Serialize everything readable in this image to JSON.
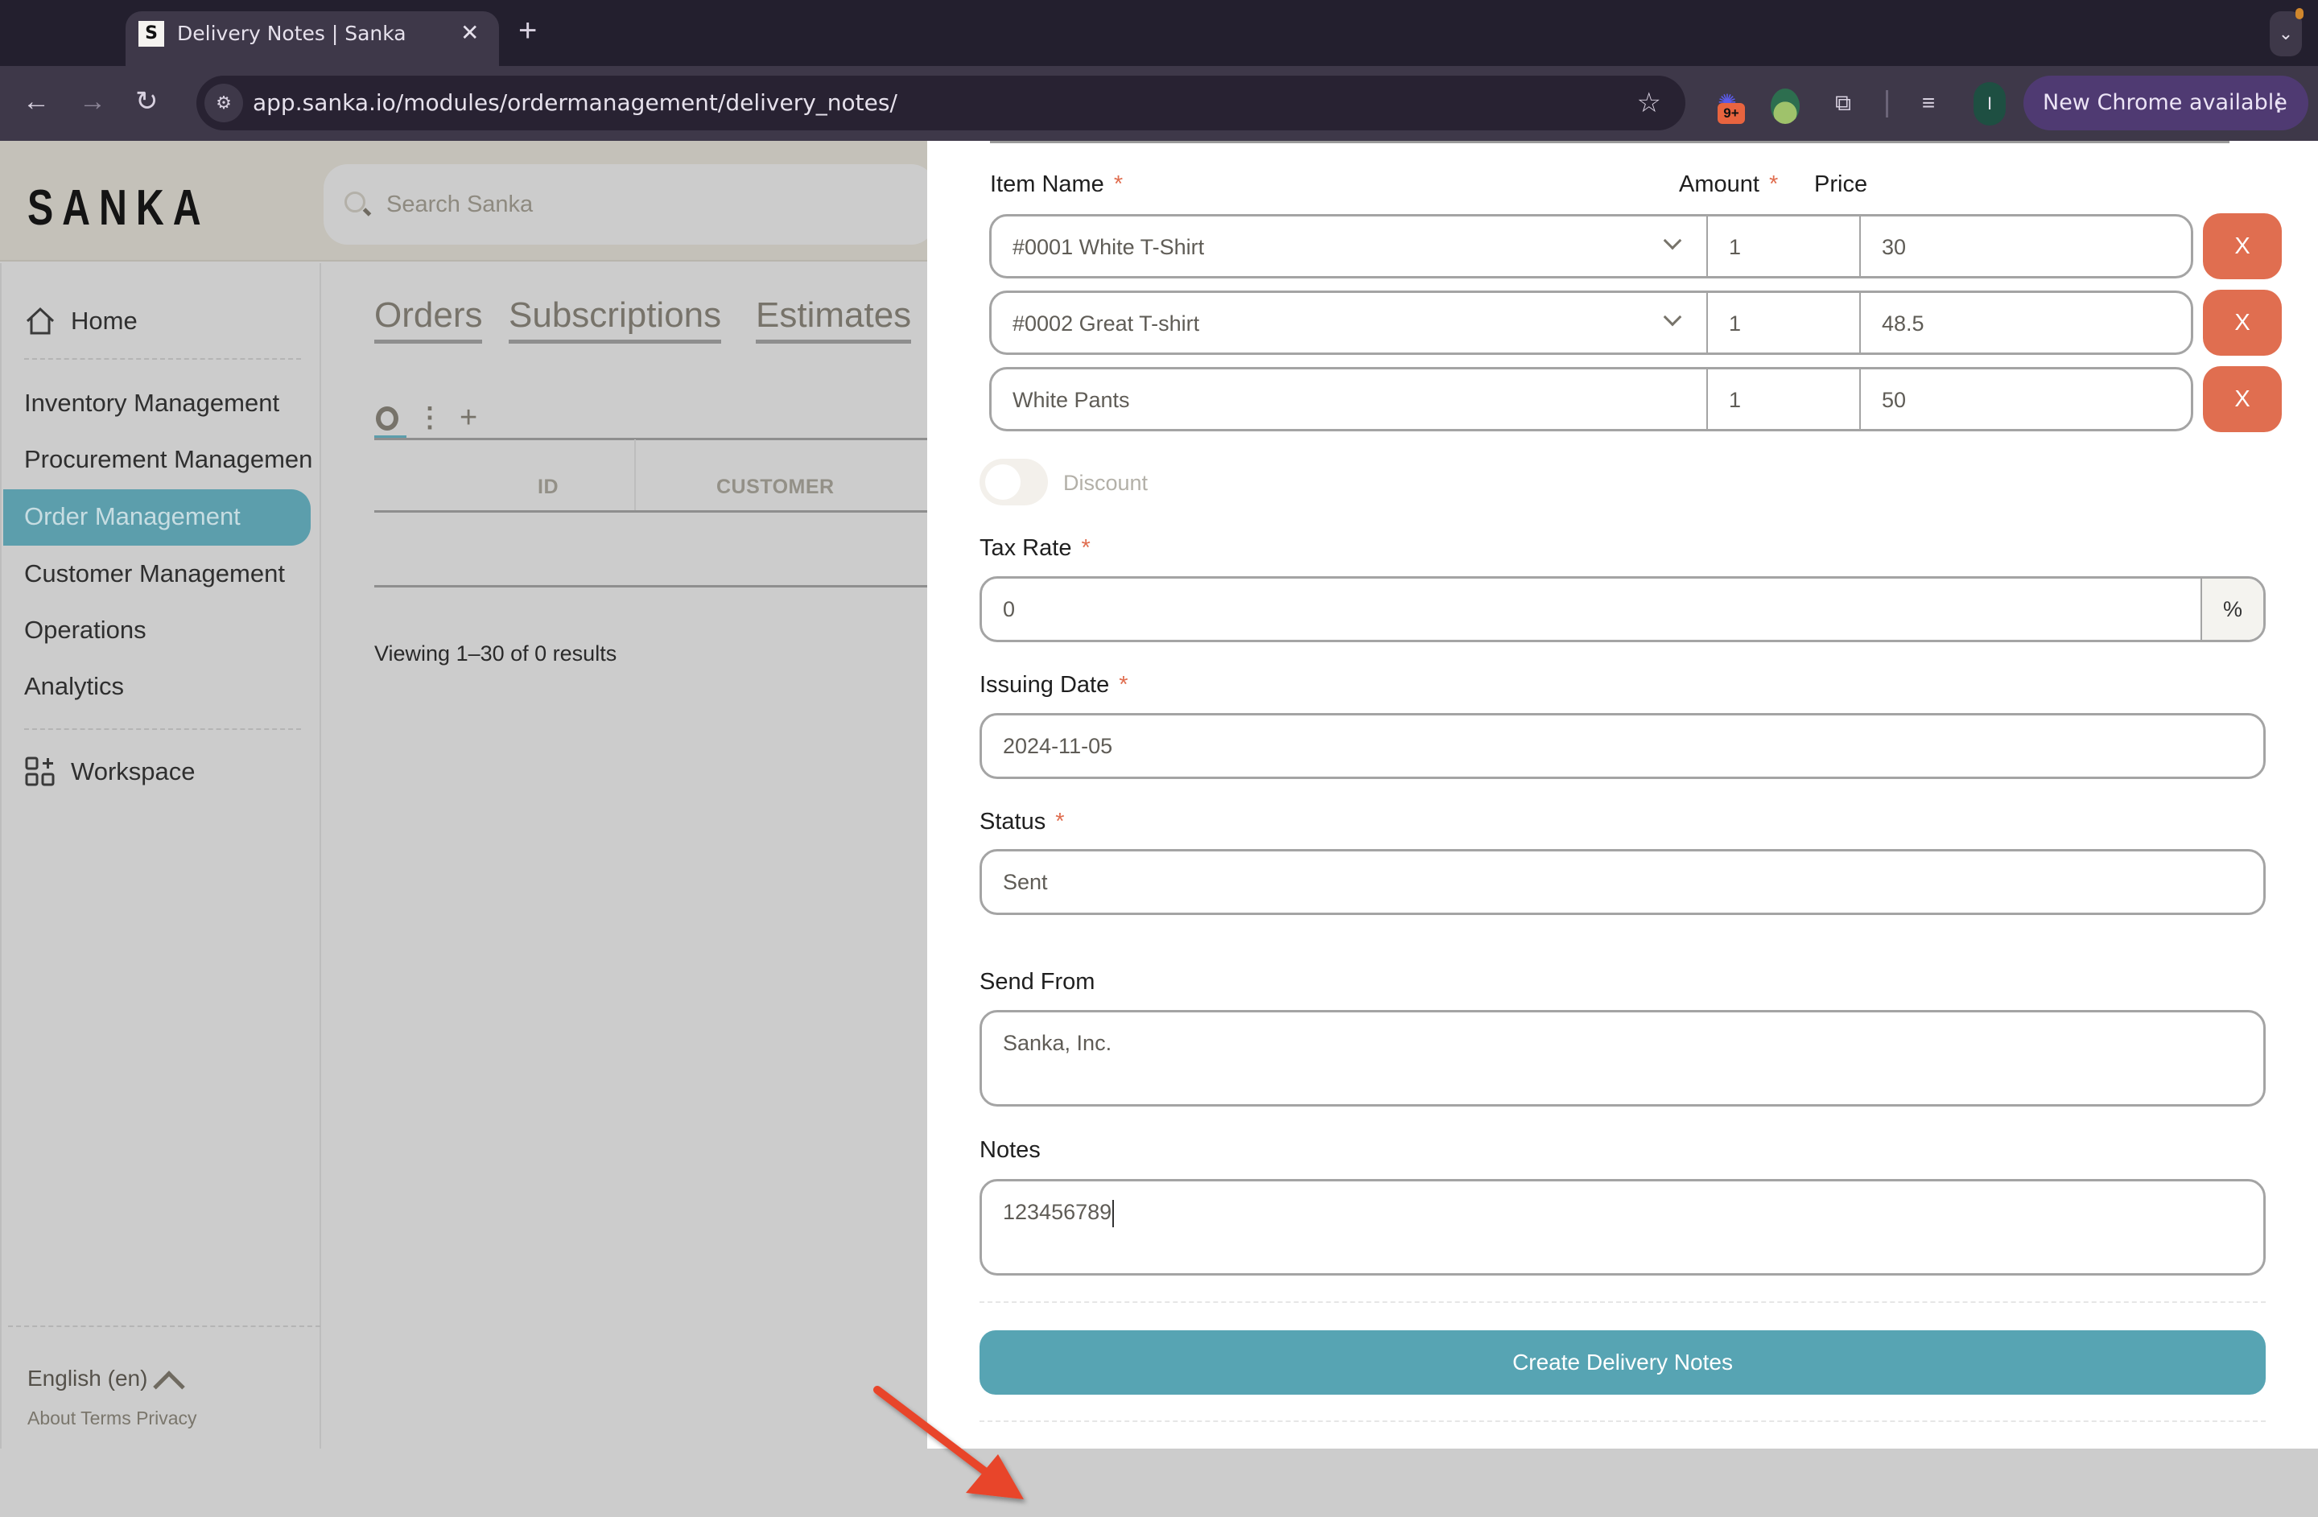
{
  "browser": {
    "tab_title": "Delivery Notes | Sanka",
    "favicon_letter": "S",
    "url": "app.sanka.io/modules/ordermanagement/delivery_notes/",
    "extension_badge": "9+",
    "profile_initial": "I",
    "update_button": "New Chrome available",
    "icons": [
      "back-icon",
      "forward-icon",
      "reload-icon",
      "site-info-icon",
      "star-icon",
      "extension-icon",
      "frog-extension-icon",
      "puzzle-icon",
      "media-icon",
      "kebab-icon",
      "tab-search-icon"
    ]
  },
  "app": {
    "logo": "SANKA",
    "search_placeholder": "Search Sanka"
  },
  "sidebar": {
    "home": "Home",
    "items": [
      {
        "label": "Inventory Management"
      },
      {
        "label": "Procurement Managemen"
      },
      {
        "label": "Order Management",
        "active": true
      },
      {
        "label": "Customer Management"
      },
      {
        "label": "Operations"
      },
      {
        "label": "Analytics"
      }
    ],
    "workspace": "Workspace",
    "language": "English (en)",
    "footer_links": "About Terms Privacy"
  },
  "main": {
    "tabs": [
      "Orders",
      "Subscriptions",
      "Estimates"
    ],
    "view_more": "⋮",
    "view_add": "+",
    "columns": [
      "ID",
      "CUSTOMER"
    ],
    "viewing_text": "Viewing 1–30 of 0 results"
  },
  "form": {
    "item_name_label": "Item Name",
    "amount_label": "Amount",
    "price_label": "Price",
    "required_mark": "*",
    "items": [
      {
        "name": "#0001 White T-Shirt",
        "amount": "1",
        "price": "30",
        "has_dropdown": true
      },
      {
        "name": "#0002 Great T-shirt",
        "amount": "1",
        "price": "48.5",
        "has_dropdown": true
      },
      {
        "name": "White Pants",
        "amount": "1",
        "price": "50",
        "has_dropdown": false
      }
    ],
    "remove_label": "X",
    "discount_label": "Discount",
    "discount_enabled": false,
    "tax_rate_label": "Tax Rate",
    "tax_rate_value": "0",
    "tax_rate_suffix": "%",
    "issuing_date_label": "Issuing Date",
    "issuing_date_value": "2024-11-05",
    "status_label": "Status",
    "status_value": "Sent",
    "send_from_label": "Send From",
    "send_from_value": "Sanka, Inc.",
    "notes_label": "Notes",
    "notes_value": "123456789",
    "submit_label": "Create Delivery Notes"
  },
  "colors": {
    "accent": "#57a4b3",
    "danger": "#e06e50",
    "annotation_arrow": "#e8452b",
    "chrome_update": "#4f3a72"
  }
}
